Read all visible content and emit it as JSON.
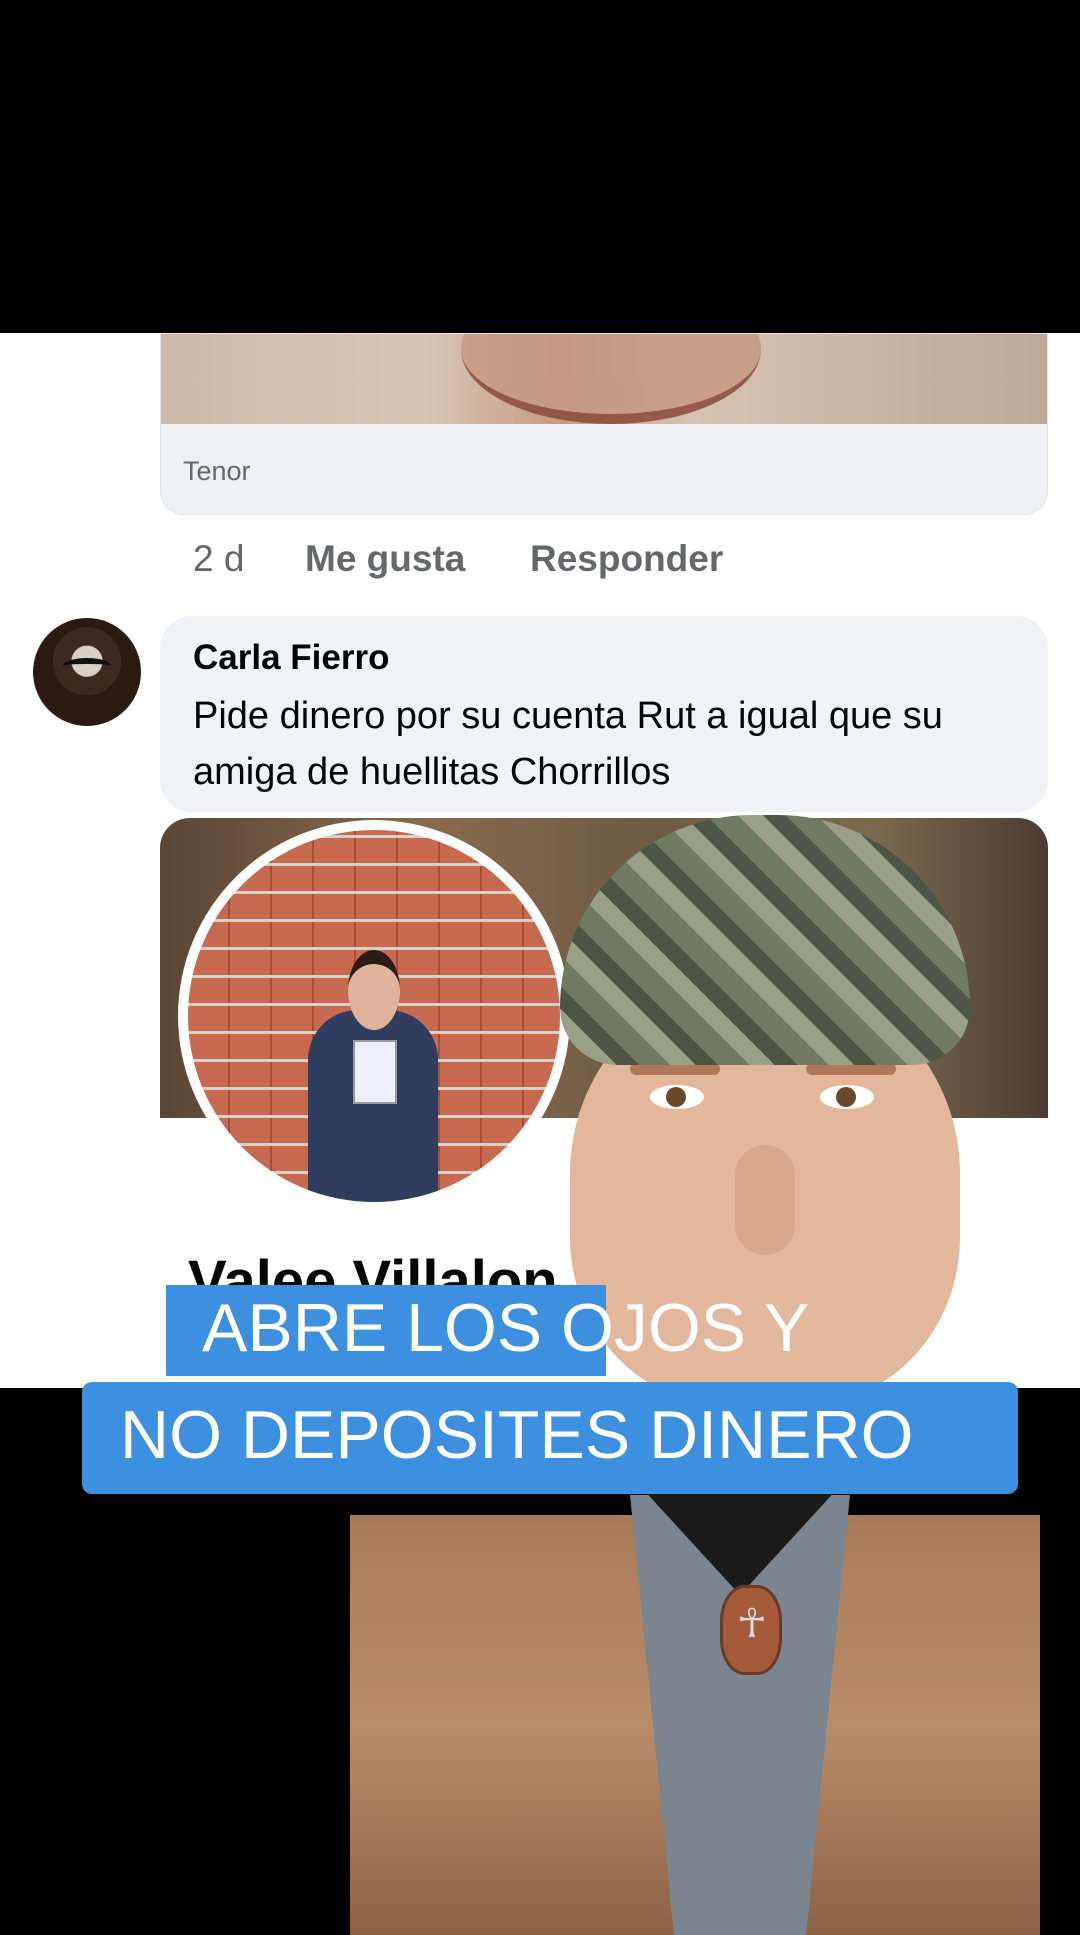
{
  "gif_card": {
    "source_label": "Tenor"
  },
  "comment_actions": {
    "time": "2 d",
    "like": "Me gusta",
    "reply": "Responder"
  },
  "comment": {
    "author": "Carla Fierro",
    "text": "Pide dinero por su cuenta Rut a igual que su amiga de huellitas Chorrillos"
  },
  "shared_profile": {
    "name": "Valee Villalon"
  },
  "caption": {
    "line1": "ABRE LOS OJOS Y",
    "line2": "NO DEPOSITES DINERO"
  },
  "colors": {
    "caption_bg": "#3d8fe0",
    "bubble_bg": "#f0f2f5",
    "meta_text": "#65676b"
  }
}
